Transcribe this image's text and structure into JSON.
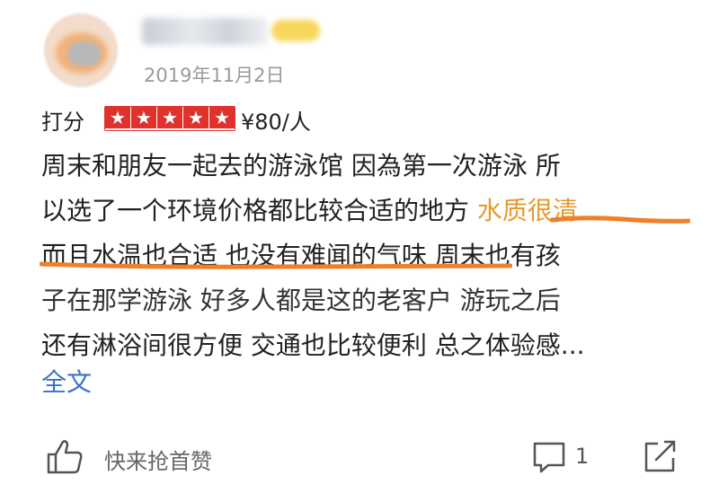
{
  "header": {
    "username": "",
    "date": "2019年11月2日"
  },
  "rating": {
    "label": "打分",
    "stars": 5,
    "price": "¥80/人"
  },
  "review": {
    "line1": "周末和朋友一起去的游泳馆 因為第一次游泳 所",
    "line2_a": "以选了一个环境价格都比较合适的地方 ",
    "line2_b": "水质很清",
    "line3": "而且水温也合适 也没有难闻的气味 周末也有孩",
    "line4": "子在那学游泳 好多人都是这的老客户 游玩之后",
    "line5": "还有淋浴间很方便 交通也比较便利 总之体验感..."
  },
  "actions": {
    "full_text": "全文",
    "like_label": "快来抢首赞",
    "comment_count": "1"
  },
  "colors": {
    "star_red": "#e0312c",
    "highlight_orange": "#e89a2e",
    "underline_orange": "#f07f2a",
    "link_blue": "#3a72c8"
  }
}
